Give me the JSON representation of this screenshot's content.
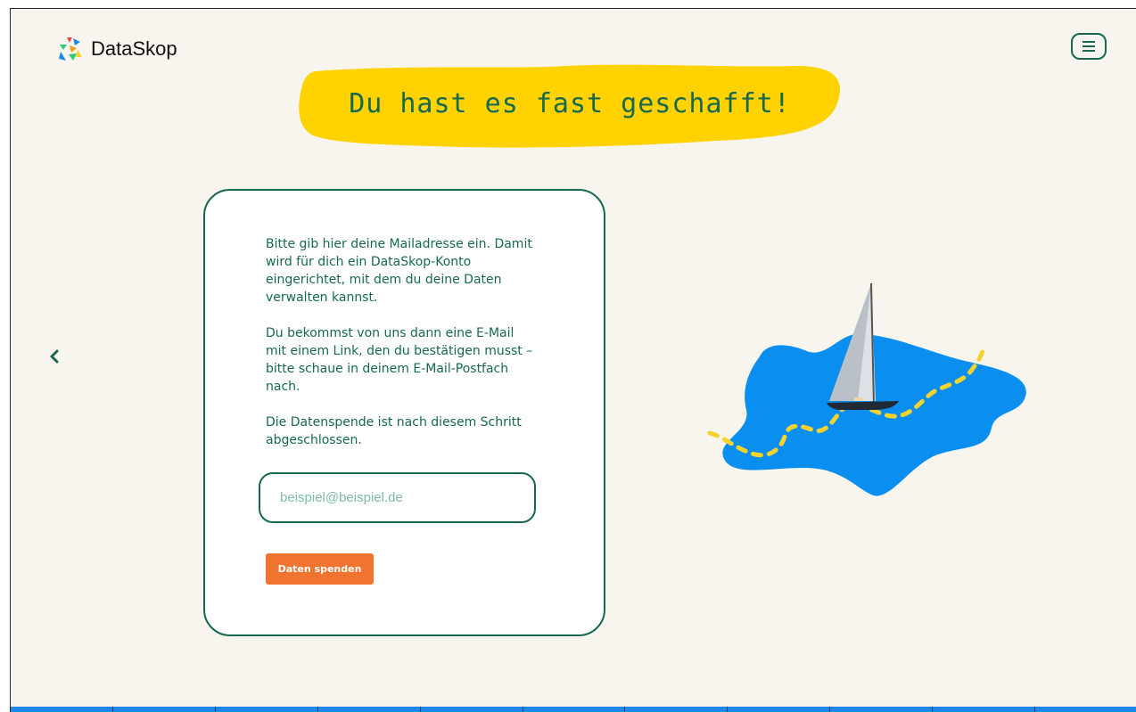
{
  "header": {
    "logo_text": "DataSkop",
    "menu_icon": "hamburger-menu-icon"
  },
  "hero": {
    "headline": "Du hast es fast geschafft!",
    "highlight_color": "#ffd200"
  },
  "navigation": {
    "back_icon": "chevron-left-icon"
  },
  "form": {
    "paragraphs": [
      "Bitte gib hier deine Mailadresse ein. Damit wird für dich ein DataSkop-Konto eingerichtet, mit dem du deine Daten verwalten kannst.",
      "Du bekommst von uns dann eine E-Mail mit einem Link, den du bestätigen musst – bitte schaue in deinem E-Mail-Postfach nach.",
      "Die Datenspende ist nach diesem Schritt abgeschlossen."
    ],
    "email_value": "",
    "email_placeholder": "beispiel@beispiel.de",
    "submit_label": "Daten spenden"
  },
  "illustration": {
    "description_icon": "sailboat-on-lake-icon"
  },
  "colors": {
    "primary_green": "#16684f",
    "accent_orange": "#f07330",
    "background": "#f8f5ee",
    "water_blue": "#0a8ff0",
    "path_yellow": "#f6d22c",
    "footer_blue": "#1e88e8"
  },
  "footer": {
    "segments": 11
  }
}
